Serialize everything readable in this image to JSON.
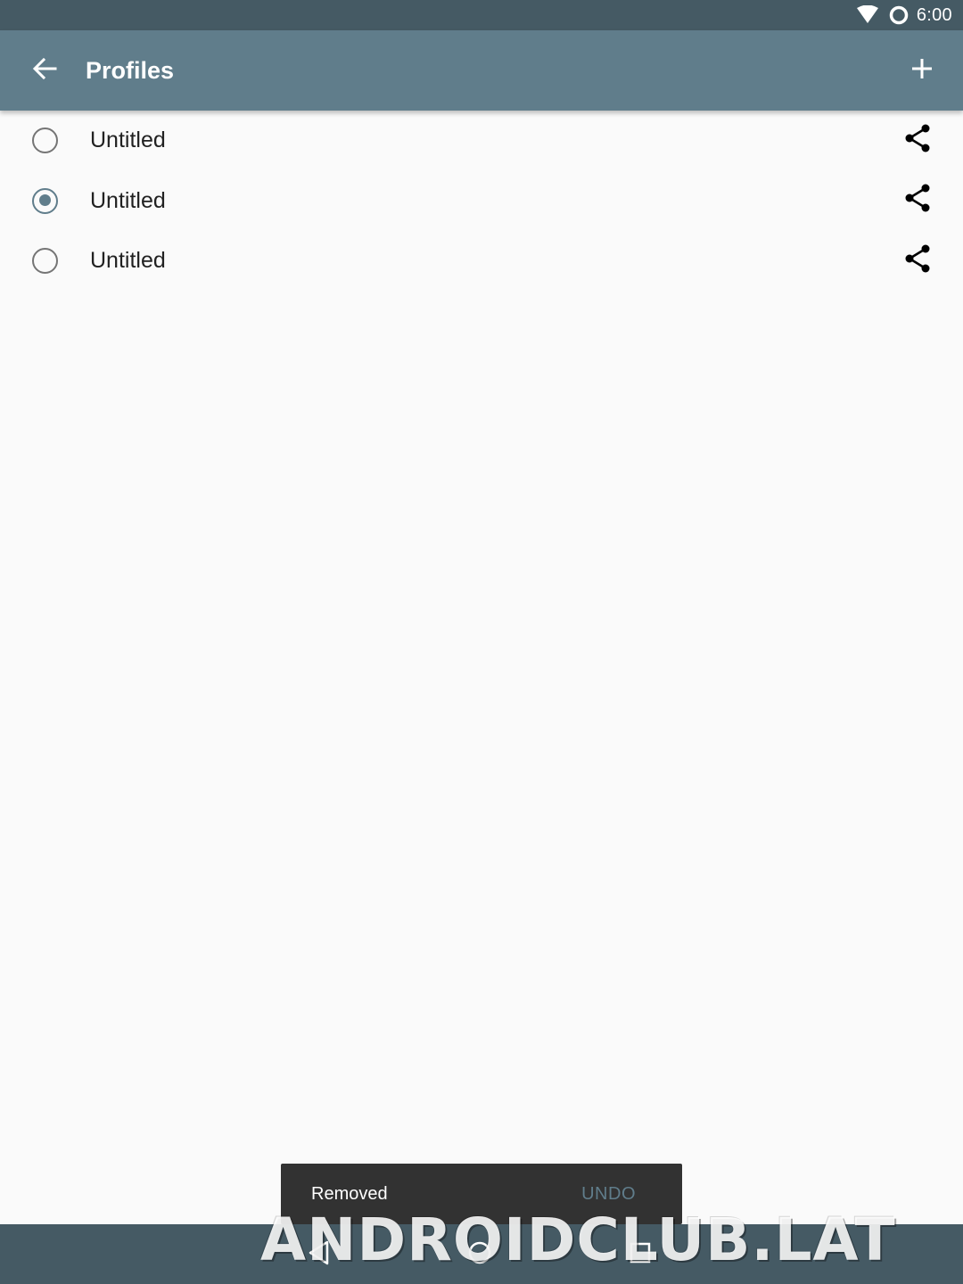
{
  "status_bar": {
    "time": "6:00",
    "icons": [
      "wifi-icon",
      "ring-icon"
    ]
  },
  "app_bar": {
    "title": "Profiles",
    "back_icon": "arrow-back-icon",
    "add_icon": "plus-icon",
    "color": "#607d8b"
  },
  "profiles": [
    {
      "name": "Untitled",
      "selected": false
    },
    {
      "name": "Untitled",
      "selected": true
    },
    {
      "name": "Untitled",
      "selected": false
    }
  ],
  "snackbar": {
    "message": "Removed",
    "action": "UNDO"
  },
  "nav_bar": {
    "buttons": [
      "back-icon",
      "home-icon",
      "recents-icon"
    ]
  },
  "watermark": {
    "text": "ANDROIDCLUB.LAT"
  },
  "colors": {
    "status_bar": "#455a64",
    "accent": "#607d8b",
    "background": "#fafafa",
    "snackbar": "#323232"
  }
}
